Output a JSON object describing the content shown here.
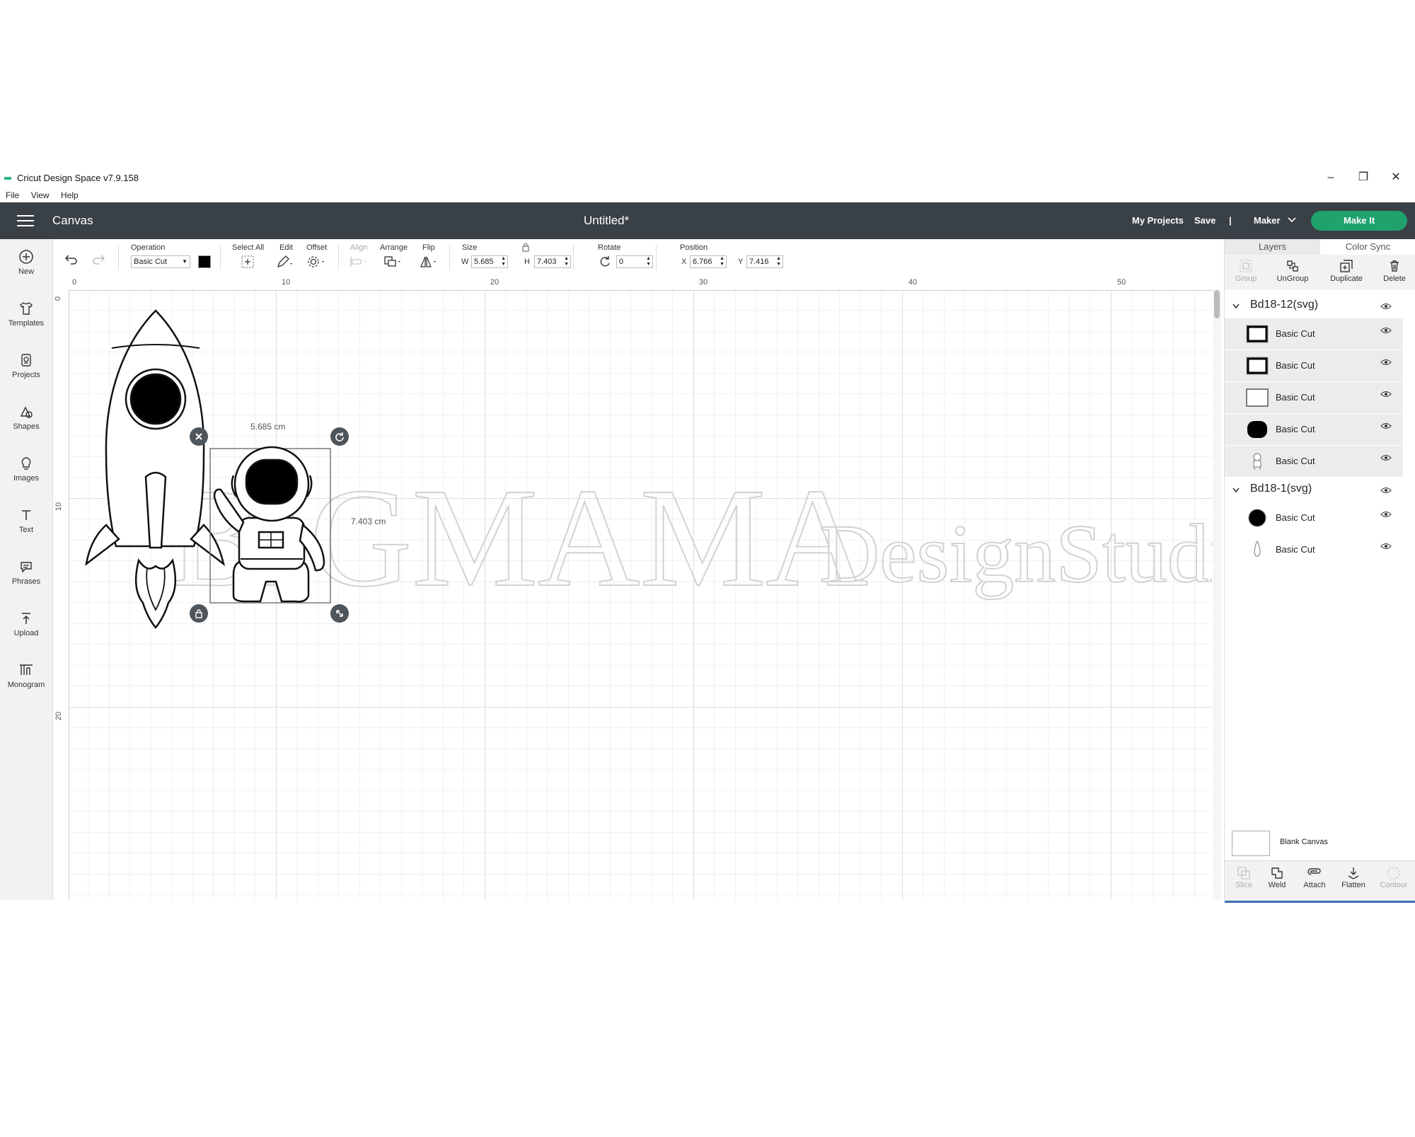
{
  "window": {
    "app_title": "Cricut Design Space  v7.9.158",
    "menu": [
      "File",
      "View",
      "Help"
    ],
    "minimize": "–",
    "restore": "❐",
    "close": "✕"
  },
  "header": {
    "canvas_label": "Canvas",
    "doc_title": "Untitled*",
    "my_projects": "My Projects",
    "save": "Save",
    "divider": "|",
    "machine": "Maker",
    "make_it": "Make It"
  },
  "sidebar": {
    "items": [
      {
        "label": "New",
        "icon": "plus-circle-icon"
      },
      {
        "label": "Templates",
        "icon": "shirt-icon"
      },
      {
        "label": "Projects",
        "icon": "projects-icon"
      },
      {
        "label": "Shapes",
        "icon": "shapes-icon"
      },
      {
        "label": "Images",
        "icon": "lightbulb-icon"
      },
      {
        "label": "Text",
        "icon": "text-icon"
      },
      {
        "label": "Phrases",
        "icon": "speech-bubble-icon"
      },
      {
        "label": "Upload",
        "icon": "upload-icon"
      },
      {
        "label": "Monogram",
        "icon": "monogram-icon"
      }
    ]
  },
  "toolbar": {
    "operation_label": "Operation",
    "operation_value": "Basic Cut",
    "select_all": "Select All",
    "edit": "Edit",
    "offset": "Offset",
    "align": "Align",
    "arrange": "Arrange",
    "flip": "Flip",
    "size_label": "Size",
    "w_label": "W",
    "w_value": "5.685",
    "h_label": "H",
    "h_value": "7.403",
    "rotate_label": "Rotate",
    "rotate_value": "0",
    "position_label": "Position",
    "x_label": "X",
    "x_value": "6.766",
    "y_label": "Y",
    "y_value": "7.416",
    "swatch_color": "#000000"
  },
  "canvas": {
    "ruler_top": [
      "0",
      "10",
      "20",
      "30",
      "40",
      "50"
    ],
    "ruler_left": [
      "0",
      "10",
      "20"
    ],
    "width_dim": "5.685 cm",
    "height_dim": "7.403 cm",
    "watermark_main": "BIGMAMA",
    "watermark_sub": "DesignStudio"
  },
  "right_panel": {
    "tabs": [
      "Layers",
      "Color Sync"
    ],
    "actions": [
      {
        "label": "Group",
        "enabled": false,
        "icon": "group-icon"
      },
      {
        "label": "UnGroup",
        "enabled": true,
        "icon": "ungroup-icon"
      },
      {
        "label": "Duplicate",
        "enabled": true,
        "icon": "duplicate-icon"
      },
      {
        "label": "Delete",
        "enabled": true,
        "icon": "trash-icon"
      }
    ],
    "groups": [
      {
        "name": "Bd18-12(svg)",
        "layers": [
          {
            "label": "Basic Cut"
          },
          {
            "label": "Basic Cut"
          },
          {
            "label": "Basic Cut"
          },
          {
            "label": "Basic Cut"
          },
          {
            "label": "Basic Cut"
          }
        ]
      },
      {
        "name": "Bd18-1(svg)",
        "layers": [
          {
            "label": "Basic Cut"
          },
          {
            "label": "Basic Cut"
          }
        ]
      }
    ],
    "blank_canvas": "Blank Canvas",
    "bottom_tools": [
      {
        "label": "Slice",
        "enabled": false,
        "icon": "slice-icon"
      },
      {
        "label": "Weld",
        "enabled": true,
        "icon": "weld-icon"
      },
      {
        "label": "Attach",
        "enabled": true,
        "icon": "attach-icon"
      },
      {
        "label": "Flatten",
        "enabled": true,
        "icon": "flatten-icon"
      },
      {
        "label": "Contour",
        "enabled": false,
        "icon": "contour-icon"
      }
    ]
  },
  "colors": {
    "header_bg": "#394046",
    "make_it_green": "#1fa26c",
    "selection_blue": "#3a6fb0"
  }
}
